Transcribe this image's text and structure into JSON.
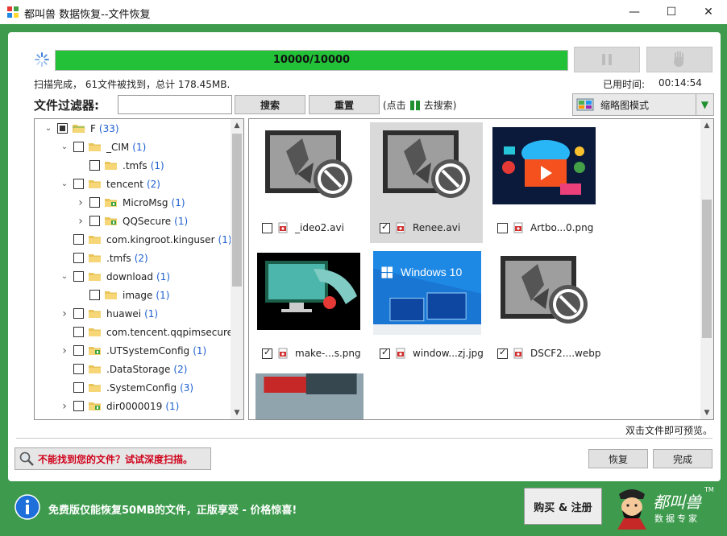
{
  "window": {
    "title": "都叫兽 数据恢复--文件恢复",
    "minimize": "—",
    "maximize": "☐",
    "close": "✕"
  },
  "progress": {
    "text": "10000/10000",
    "fraction": 1.0,
    "color": "#22c137"
  },
  "status": {
    "scan": "扫描完成， 61文件被找到，总计 178.45MB.",
    "elapsed_label": "已用时间:",
    "elapsed_value": "00:14:54"
  },
  "filter": {
    "label": "文件过滤器:",
    "input_value": "",
    "search_label": "搜索",
    "reset_label": "重置",
    "hint_prefix": "(点击",
    "hint_suffix": "去搜索)"
  },
  "view_mode": {
    "selected": "缩略图模式"
  },
  "tree": {
    "items": [
      {
        "label": "F",
        "count": "(33)",
        "level": 0,
        "expander": "down",
        "check": "partial",
        "folder": "open"
      },
      {
        "label": "_CIM",
        "count": "(1)",
        "level": 1,
        "expander": "down",
        "check": "none",
        "folder": "plain"
      },
      {
        "label": ".tmfs",
        "count": "(1)",
        "level": 2,
        "expander": "",
        "check": "none",
        "folder": "plain"
      },
      {
        "label": "tencent",
        "count": "(2)",
        "level": 1,
        "expander": "down",
        "check": "none",
        "folder": "plain"
      },
      {
        "label": "MicroMsg",
        "count": "(1)",
        "level": 2,
        "expander": "right",
        "check": "none",
        "folder": "green"
      },
      {
        "label": "QQSecure",
        "count": "(1)",
        "level": 2,
        "expander": "right",
        "check": "none",
        "folder": "green"
      },
      {
        "label": "com.kingroot.kinguser",
        "count": "(1)",
        "level": 1,
        "expander": "",
        "check": "none",
        "folder": "plain"
      },
      {
        "label": ".tmfs",
        "count": "(2)",
        "level": 1,
        "expander": "",
        "check": "none",
        "folder": "plain"
      },
      {
        "label": "download",
        "count": "(1)",
        "level": 1,
        "expander": "down",
        "check": "none",
        "folder": "plain"
      },
      {
        "label": "image",
        "count": "(1)",
        "level": 2,
        "expander": "",
        "check": "none",
        "folder": "plain"
      },
      {
        "label": "huawei",
        "count": "(1)",
        "level": 1,
        "expander": "right",
        "check": "none",
        "folder": "plain"
      },
      {
        "label": "com.tencent.qqpimsecure",
        "count": "(1",
        "level": 1,
        "expander": "",
        "check": "none",
        "folder": "plain"
      },
      {
        "label": ".UTSystemConfig",
        "count": "(1)",
        "level": 1,
        "expander": "right",
        "check": "none",
        "folder": "green"
      },
      {
        "label": ".DataStorage",
        "count": "(2)",
        "level": 1,
        "expander": "",
        "check": "none",
        "folder": "plain"
      },
      {
        "label": ".SystemConfig",
        "count": "(3)",
        "level": 1,
        "expander": "",
        "check": "none",
        "folder": "plain"
      },
      {
        "label": "dir0000019",
        "count": "(1)",
        "level": 1,
        "expander": "right",
        "check": "none",
        "folder": "green"
      }
    ]
  },
  "files": [
    {
      "name": "_ideo2.avi",
      "checked": false,
      "thumb": "video",
      "selected": false
    },
    {
      "name": "Renee.avi",
      "checked": true,
      "thumb": "video",
      "selected": true
    },
    {
      "name": "Artbo...0.png",
      "checked": false,
      "thumb": "artboard",
      "selected": false
    },
    {
      "name": "make-...s.png",
      "checked": true,
      "thumb": "monitor",
      "selected": false
    },
    {
      "name": "window...zj.jpg",
      "checked": true,
      "thumb": "windows10",
      "selected": false
    },
    {
      "name": "DSCF2....webp",
      "checked": true,
      "thumb": "video",
      "selected": false
    },
    {
      "name": "",
      "checked": false,
      "thumb": "photo",
      "selected": false
    }
  ],
  "windows10_text": "Windows 10",
  "dblclick_hint": "双击文件即可预览。",
  "deep_scan": "不能找到您的文件？试试深度扫描。",
  "recover_label": "恢复",
  "finish_label": "完成",
  "banner": {
    "text": "免费版仅能恢复50MB的文件，正版享受 - 价格惊喜!",
    "buy_label": "购买 & 注册",
    "brand_name": "都叫兽",
    "brand_tm": "TM",
    "brand_sub": "数据专家"
  },
  "colors": {
    "frame_green": "#3e9b4e",
    "progress_green": "#22c137",
    "deep_scan_red": "#d0021b",
    "count_blue": "#1c5fd0"
  }
}
